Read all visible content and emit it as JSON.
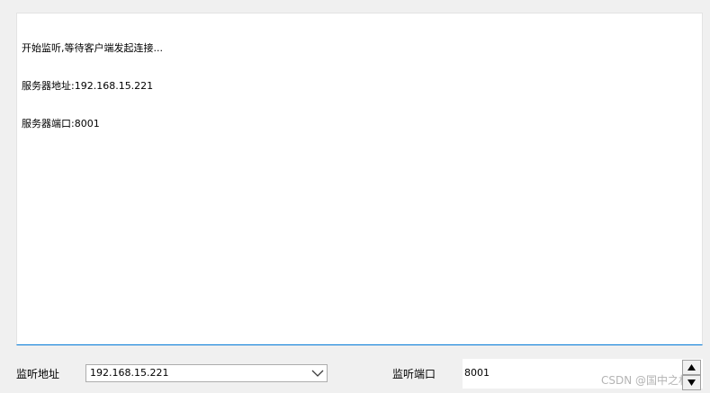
{
  "log": {
    "lines": [
      "开始监听,等待客户端发起连接...",
      "服务器地址:192.168.15.221",
      "服务器端口:8001"
    ]
  },
  "address": {
    "label": "监听地址",
    "value": "192.168.15.221",
    "arrow_icon": "chevron-down-icon"
  },
  "port": {
    "label": "监听端口",
    "value": "8001",
    "up_icon": "triangle-up-icon",
    "down_icon": "triangle-down-icon"
  },
  "watermark": {
    "text": "CSDN @国中之林"
  },
  "colors": {
    "focus_border": "#0078d7",
    "background": "#f0f0f0"
  }
}
